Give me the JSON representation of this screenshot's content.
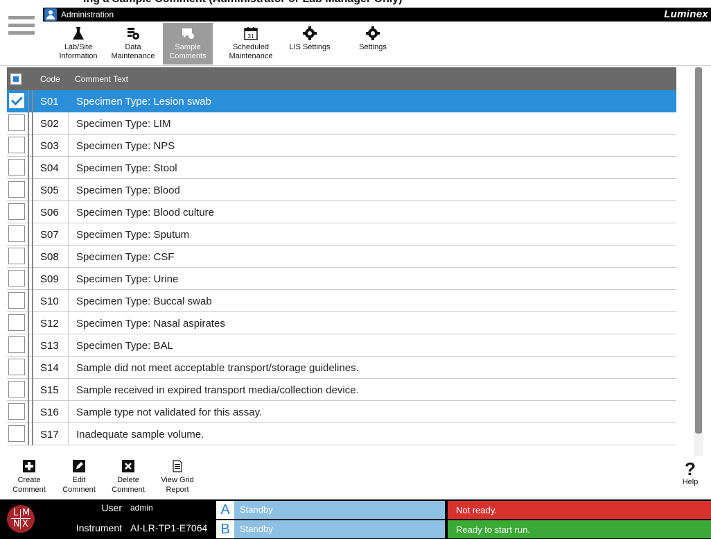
{
  "page_heading_partial": "ing a Sample Comment (Administrator or Lab Manager Only)",
  "header": {
    "section_title": "Administration",
    "brand": "Luminex"
  },
  "nav": {
    "tabs": [
      {
        "label": "Lab/Site Information",
        "icon": "flask-icon",
        "active": false
      },
      {
        "label": "Data Maintenance",
        "icon": "data-gear-icon",
        "active": false
      },
      {
        "label": "Sample Comments",
        "icon": "comment-icon",
        "active": true
      },
      {
        "label": "Scheduled Maintenance",
        "icon": "calendar-icon",
        "active": false
      },
      {
        "label": "LIS Settings",
        "icon": "gear-icon",
        "active": false
      },
      {
        "label": "Settings",
        "icon": "gear-icon",
        "active": false
      }
    ],
    "calendar_day": "31"
  },
  "table": {
    "col_code": "Code",
    "col_text": "Comment Text",
    "rows": [
      {
        "code": "S01",
        "text": "Specimen Type: Lesion swab",
        "selected": true
      },
      {
        "code": "S02",
        "text": "Specimen Type: LIM",
        "selected": false
      },
      {
        "code": "S03",
        "text": "Specimen Type: NPS",
        "selected": false
      },
      {
        "code": "S04",
        "text": "Specimen Type: Stool",
        "selected": false
      },
      {
        "code": "S05",
        "text": "Specimen Type: Blood",
        "selected": false
      },
      {
        "code": "S06",
        "text": "Specimen Type: Blood culture",
        "selected": false
      },
      {
        "code": "S07",
        "text": "Specimen Type: Sputum",
        "selected": false
      },
      {
        "code": "S08",
        "text": "Specimen Type: CSF",
        "selected": false
      },
      {
        "code": "S09",
        "text": "Specimen Type: Urine",
        "selected": false
      },
      {
        "code": "S10",
        "text": "Specimen Type: Buccal swab",
        "selected": false
      },
      {
        "code": "S12",
        "text": "Specimen Type: Nasal aspirates",
        "selected": false
      },
      {
        "code": "S13",
        "text": "Specimen Type: BAL",
        "selected": false
      },
      {
        "code": "S14",
        "text": "Sample did not meet acceptable transport/storage guidelines.",
        "selected": false
      },
      {
        "code": "S15",
        "text": "Sample received in expired transport media/collection device.",
        "selected": false
      },
      {
        "code": "S16",
        "text": "Sample type not validated for this assay.",
        "selected": false
      },
      {
        "code": "S17",
        "text": "Inadequate sample volume.",
        "selected": false
      }
    ]
  },
  "toolbar": {
    "create": "Create Comment",
    "edit": "Edit Comment",
    "delete": "Delete Comment",
    "report": "View Grid Report",
    "help": "Help",
    "help_glyph": "?"
  },
  "status": {
    "logo_letters": [
      "L",
      "M",
      "N",
      "X"
    ],
    "user_label": "User",
    "user_value": "admin",
    "instrument_label": "Instrument",
    "instrument_value": "AI-LR-TP1-E7064",
    "bay_a_letter": "A",
    "bay_a_status": "Standby",
    "bay_b_letter": "B",
    "bay_b_status": "Standby",
    "ready_a": "Not ready.",
    "ready_b": "Ready to start run.",
    "colors": {
      "not_ready": "#d9322e",
      "ready": "#3aa935",
      "bay": "#8ec0e4",
      "selected_row": "#2a8ed8"
    }
  }
}
